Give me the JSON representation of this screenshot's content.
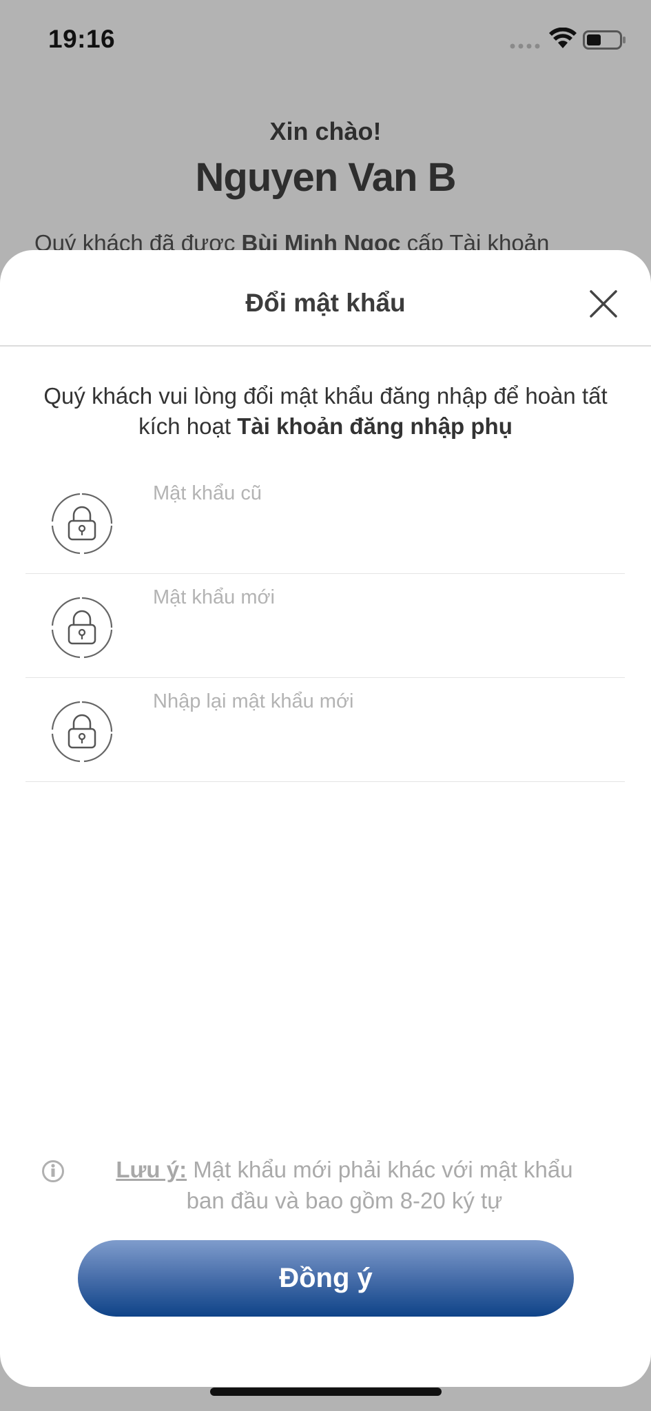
{
  "status_bar": {
    "time": "19:16",
    "signal_icon": "signal-dots-icon",
    "wifi_icon": "wifi-icon",
    "battery_icon": "battery-icon"
  },
  "background": {
    "greeting": "Xin chào!",
    "name": "Nguyen Van B",
    "desc_prefix": "Quý khách đã được ",
    "desc_bold": "Bùi Minh Ngọc",
    "desc_suffix": " cấp Tài khoản"
  },
  "sheet": {
    "title": "Đổi mật khẩu",
    "close_icon": "close-icon",
    "instruction_prefix": "Quý khách vui lòng đổi mật khẩu đăng nhập để hoàn tất kích hoạt ",
    "instruction_bold": "Tài khoản đăng nhập phụ",
    "fields": [
      {
        "placeholder": "Mật khẩu cũ",
        "value": "",
        "icon": "lock-icon"
      },
      {
        "placeholder": "Mật khẩu mới",
        "value": "",
        "icon": "lock-icon"
      },
      {
        "placeholder": "Nhập lại mật khẩu mới",
        "value": "",
        "icon": "lock-icon"
      }
    ],
    "note": {
      "icon": "info-icon",
      "label": "Lưu ý:",
      "text": " Mật khẩu mới phải khác với mật khẩu ban đầu và bao gồm 8-20 ký tự"
    },
    "submit_label": "Đồng ý"
  },
  "colors": {
    "overlay": "#b3b3b3",
    "button_top": "#7f9ccc",
    "button_bottom": "#0e4388",
    "placeholder": "#b3b3b3",
    "note_text": "#aaaaaa"
  }
}
